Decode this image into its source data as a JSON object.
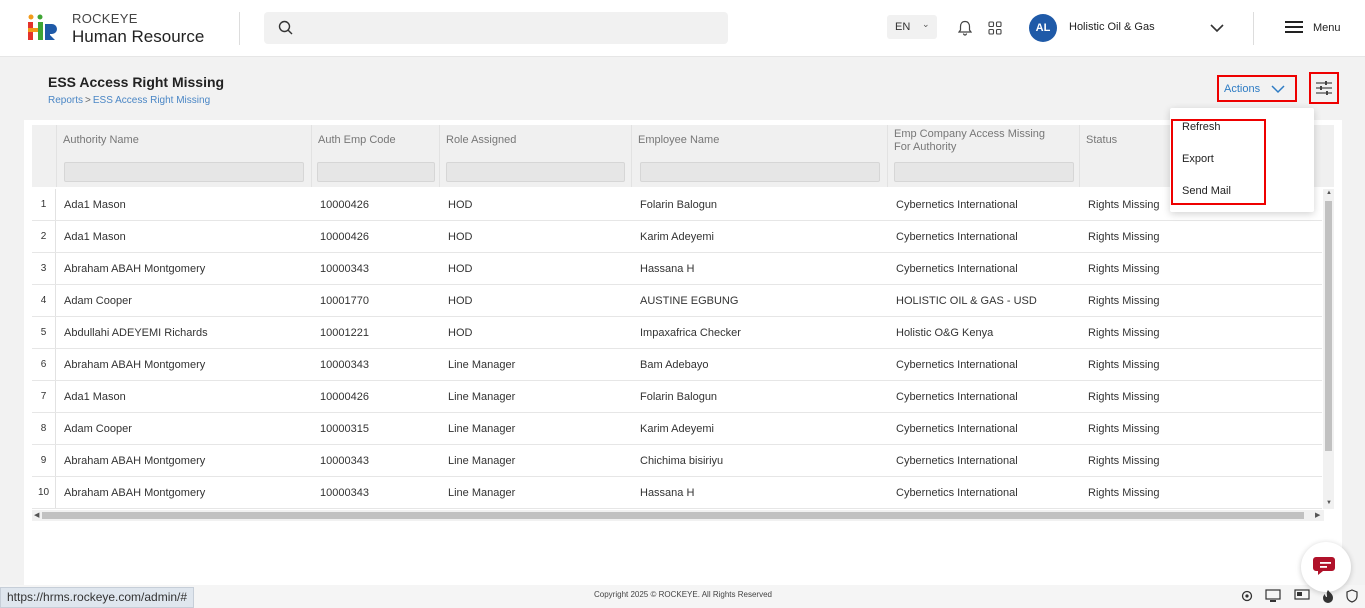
{
  "header": {
    "brand_top": "ROCKEYE",
    "brand_bottom": "Human Resource",
    "language": "EN",
    "avatar_initials": "AL",
    "company": "Holistic Oil & Gas",
    "menu_label": "Menu",
    "search_placeholder": ""
  },
  "page": {
    "title": "ESS Access Right Missing",
    "breadcrumb": [
      "Reports",
      "ESS Access Right Missing"
    ],
    "actions_label": "Actions"
  },
  "actions_menu": [
    "Refresh",
    "Export",
    "Send Mail"
  ],
  "table": {
    "columns": [
      "Authority Name",
      "Auth Emp Code",
      "Role Assigned",
      "Employee Name",
      "Emp Company Access Missing For Authority",
      "Status"
    ],
    "rows": [
      {
        "n": "1",
        "authority": "Ada1 Mason",
        "code": "10000426",
        "role": "HOD",
        "employee": "Folarin Balogun",
        "company": "Cybernetics International",
        "status": "Rights Missing"
      },
      {
        "n": "2",
        "authority": "Ada1 Mason",
        "code": "10000426",
        "role": "HOD",
        "employee": "Karim Adeyemi",
        "company": "Cybernetics International",
        "status": "Rights Missing"
      },
      {
        "n": "3",
        "authority": "Abraham ABAH Montgomery",
        "code": "10000343",
        "role": "HOD",
        "employee": "Hassana H",
        "company": "Cybernetics International",
        "status": "Rights Missing"
      },
      {
        "n": "4",
        "authority": "Adam Cooper",
        "code": "10001770",
        "role": "HOD",
        "employee": "AUSTINE EGBUNG",
        "company": "HOLISTIC OIL & GAS - USD",
        "status": "Rights Missing"
      },
      {
        "n": "5",
        "authority": "Abdullahi ADEYEMI Richards",
        "code": "10001221",
        "role": "HOD",
        "employee": "Impaxafrica Checker",
        "company": "Holistic O&G Kenya",
        "status": "Rights Missing"
      },
      {
        "n": "6",
        "authority": "Abraham ABAH Montgomery",
        "code": "10000343",
        "role": "Line Manager",
        "employee": "Bam Adebayo",
        "company": "Cybernetics International",
        "status": "Rights Missing"
      },
      {
        "n": "7",
        "authority": "Ada1 Mason",
        "code": "10000426",
        "role": "Line Manager",
        "employee": "Folarin Balogun",
        "company": "Cybernetics International",
        "status": "Rights Missing"
      },
      {
        "n": "8",
        "authority": "Adam Cooper",
        "code": "10000315",
        "role": "Line Manager",
        "employee": "Karim Adeyemi",
        "company": "Cybernetics International",
        "status": "Rights Missing"
      },
      {
        "n": "9",
        "authority": "Abraham ABAH Montgomery",
        "code": "10000343",
        "role": "Line Manager",
        "employee": "Chichima bisiriyu",
        "company": "Cybernetics International",
        "status": "Rights Missing"
      },
      {
        "n": "10",
        "authority": "Abraham ABAH Montgomery",
        "code": "10000343",
        "role": "Line Manager",
        "employee": "Hassana H",
        "company": "Cybernetics International",
        "status": "Rights Missing"
      }
    ]
  },
  "footer": {
    "copyright": "Copyright 2025 © ROCKEYE. All Rights Reserved",
    "status_url": "https://hrms.rockeye.com/admin/#"
  },
  "icons": {
    "search": "search-icon",
    "bell": "bell-icon",
    "apps": "apps-grid-icon",
    "chevron": "chevron-down-icon",
    "menu": "hamburger-icon",
    "filter": "sliders-icon",
    "chat": "chat-icon"
  },
  "colors": {
    "accent": "#2e7cc4",
    "highlight_border": "#ee0000",
    "avatar": "#1f5aa8",
    "chat": "#b0122a"
  }
}
